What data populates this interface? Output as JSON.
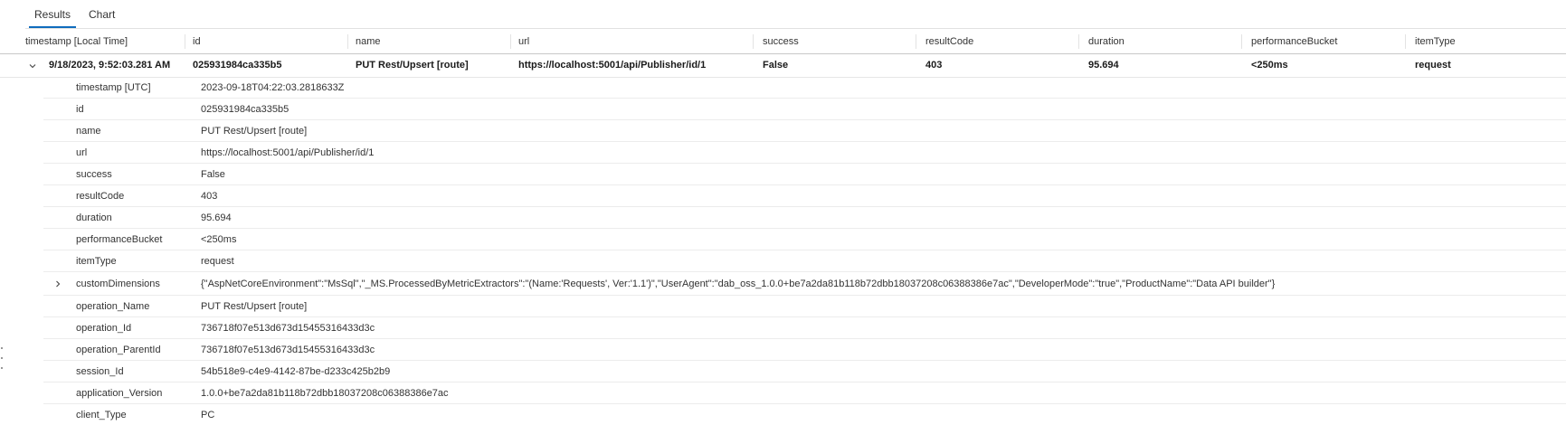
{
  "tabs": [
    {
      "label": "Results",
      "active": true
    },
    {
      "label": "Chart",
      "active": false
    }
  ],
  "columns": [
    "timestamp [Local Time]",
    "id",
    "name",
    "url",
    "success",
    "resultCode",
    "duration",
    "performanceBucket",
    "itemType"
  ],
  "row": {
    "timestamp": "9/18/2023, 9:52:03.281 AM",
    "id": "025931984ca335b5",
    "name": "PUT Rest/Upsert [route]",
    "url": "https://localhost:5001/api/Publisher/id/1",
    "success": "False",
    "resultCode": "403",
    "duration": "95.694",
    "performanceBucket": "<250ms",
    "itemType": "request"
  },
  "details": [
    {
      "key": "timestamp [UTC]",
      "value": "2023-09-18T04:22:03.2818633Z"
    },
    {
      "key": "id",
      "value": "025931984ca335b5"
    },
    {
      "key": "name",
      "value": "PUT Rest/Upsert [route]"
    },
    {
      "key": "url",
      "value": "https://localhost:5001/api/Publisher/id/1"
    },
    {
      "key": "success",
      "value": "False"
    },
    {
      "key": "resultCode",
      "value": "403"
    },
    {
      "key": "duration",
      "value": "95.694"
    },
    {
      "key": "performanceBucket",
      "value": "<250ms"
    },
    {
      "key": "itemType",
      "value": "request"
    },
    {
      "key": "customDimensions",
      "value": "{\"AspNetCoreEnvironment\":\"MsSql\",\"_MS.ProcessedByMetricExtractors\":\"(Name:'Requests', Ver:'1.1')\",\"UserAgent\":\"dab_oss_1.0.0+be7a2da81b118b72dbb18037208c06388386e7ac\",\"DeveloperMode\":\"true\",\"ProductName\":\"Data API builder\"}"
    },
    {
      "key": "operation_Name",
      "value": "PUT Rest/Upsert [route]"
    },
    {
      "key": "operation_Id",
      "value": "736718f07e513d673d15455316433d3c"
    },
    {
      "key": "operation_ParentId",
      "value": "736718f07e513d673d15455316433d3c"
    },
    {
      "key": "session_Id",
      "value": "54b518e9-c4e9-4142-87be-d233c425b2b9"
    },
    {
      "key": "application_Version",
      "value": "1.0.0+be7a2da81b118b72dbb18037208c06388386e7ac"
    },
    {
      "key": "client_Type",
      "value": "PC"
    }
  ],
  "colors": {
    "accent": "#0f6cbd"
  },
  "icons": {
    "row_toggle": "chevron-down-icon",
    "custom_dims_toggle": "chevron-right-icon",
    "splitter": "grip-dots-icon"
  }
}
